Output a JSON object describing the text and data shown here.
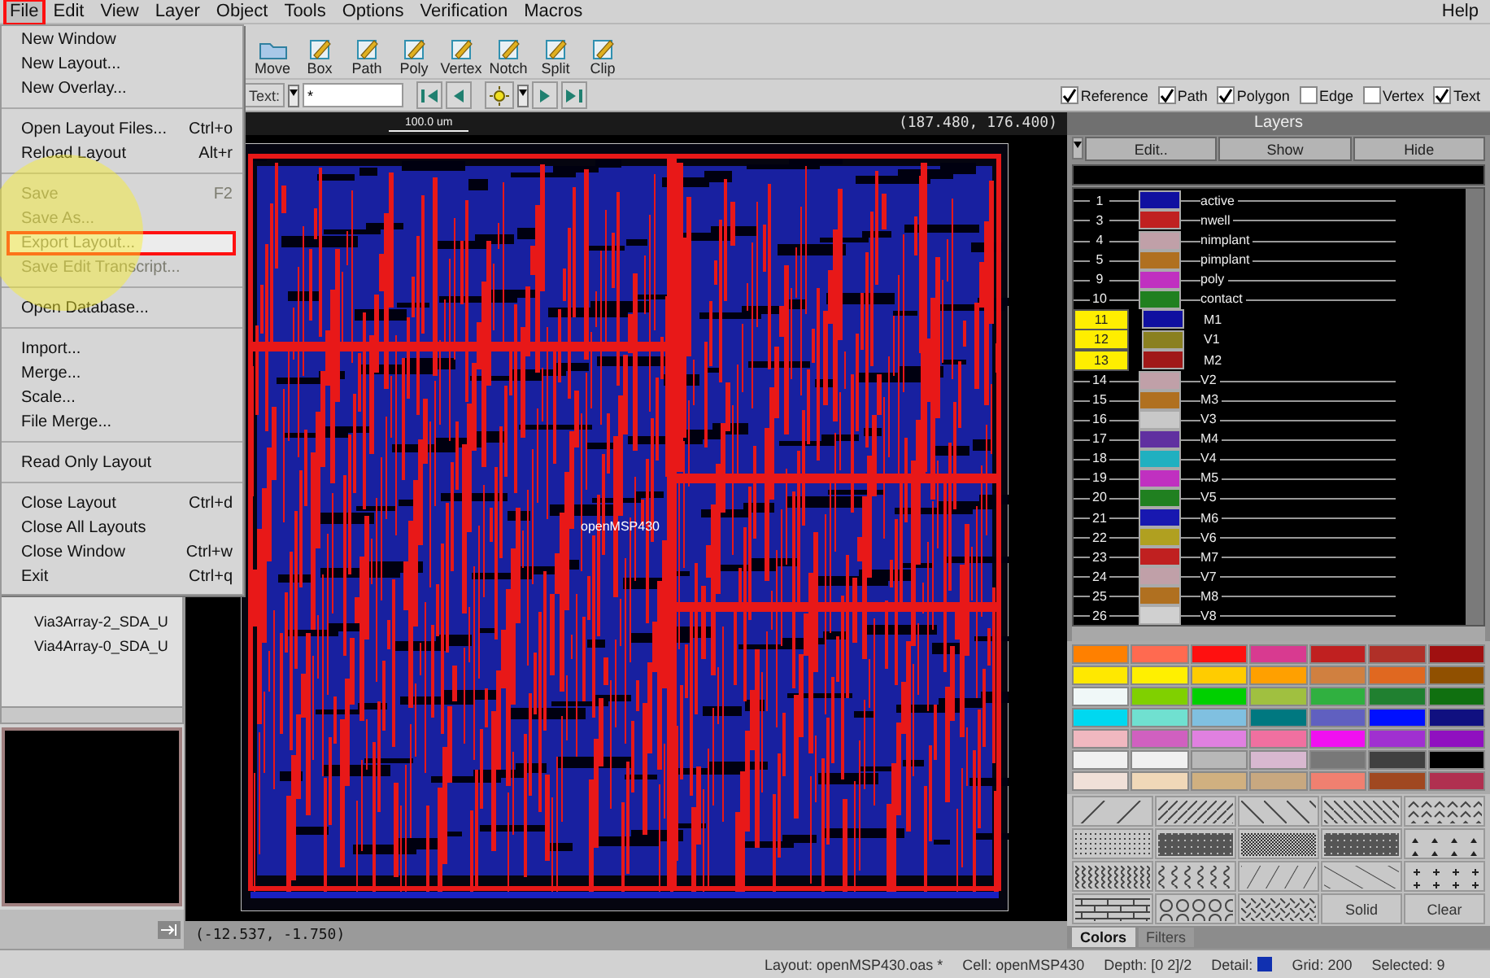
{
  "menubar": {
    "menus": [
      {
        "label": "File",
        "selected": true,
        "annotated": true
      },
      {
        "label": "Edit",
        "selected": false,
        "annotated": false
      },
      {
        "label": "View",
        "selected": false,
        "annotated": false
      },
      {
        "label": "Layer",
        "selected": false,
        "annotated": false
      },
      {
        "label": "Object",
        "selected": false,
        "annotated": false
      },
      {
        "label": "Tools",
        "selected": false,
        "annotated": false
      },
      {
        "label": "Options",
        "selected": false,
        "annotated": false
      },
      {
        "label": "Verification",
        "selected": false,
        "annotated": false
      },
      {
        "label": "Macros",
        "selected": false,
        "annotated": false
      }
    ],
    "help": "Help"
  },
  "file_menu": [
    {
      "kind": "item",
      "label": "New Window",
      "disabled": false,
      "annotated": false
    },
    {
      "kind": "item",
      "label": "New Layout...",
      "disabled": false,
      "annotated": false
    },
    {
      "kind": "item",
      "label": "New Overlay...",
      "disabled": false,
      "annotated": false
    },
    {
      "kind": "separator"
    },
    {
      "kind": "item",
      "label": "Open Layout Files...",
      "shortcut": "Ctrl+o",
      "disabled": false,
      "annotated": false
    },
    {
      "kind": "item",
      "label": "Reload Layout",
      "shortcut": "Alt+r",
      "disabled": false,
      "annotated": false
    },
    {
      "kind": "separator"
    },
    {
      "kind": "item",
      "label": "Save",
      "shortcut": "F2",
      "disabled": true,
      "annotated": false
    },
    {
      "kind": "item",
      "label": "Save As...",
      "disabled": true,
      "annotated": false
    },
    {
      "kind": "item",
      "label": "Export Layout...",
      "disabled": true,
      "annotated": true
    },
    {
      "kind": "item",
      "label": "Save Edit Transcript...",
      "disabled": true,
      "annotated": false
    },
    {
      "kind": "separator"
    },
    {
      "kind": "item",
      "label": "Open Database...",
      "disabled": false,
      "annotated": false
    },
    {
      "kind": "separator"
    },
    {
      "kind": "item",
      "label": "Import...",
      "disabled": false,
      "annotated": false
    },
    {
      "kind": "item",
      "label": "Merge...",
      "disabled": false,
      "annotated": false
    },
    {
      "kind": "item",
      "label": "Scale...",
      "disabled": false,
      "annotated": false
    },
    {
      "kind": "item",
      "label": "File Merge...",
      "disabled": false,
      "annotated": false
    },
    {
      "kind": "separator"
    },
    {
      "kind": "item",
      "label": "Read Only Layout",
      "disabled": false,
      "annotated": false
    },
    {
      "kind": "separator"
    },
    {
      "kind": "item",
      "label": "Close Layout",
      "shortcut": "Ctrl+d",
      "disabled": false,
      "annotated": false
    },
    {
      "kind": "item",
      "label": "Close All Layouts",
      "disabled": false,
      "annotated": false
    },
    {
      "kind": "item",
      "label": "Close Window",
      "shortcut": "Ctrl+w",
      "disabled": false,
      "annotated": false
    },
    {
      "kind": "item",
      "label": "Exit",
      "shortcut": "Ctrl+q",
      "disabled": false,
      "annotated": false
    }
  ],
  "tools": [
    "Move",
    "Box",
    "Path",
    "Poly",
    "Vertex",
    "Notch",
    "Split",
    "Clip"
  ],
  "filter_bar": {
    "text_mode": "Text:",
    "pattern": "*"
  },
  "show_filters": [
    {
      "label": "Reference",
      "checked": true
    },
    {
      "label": "Path",
      "checked": true
    },
    {
      "label": "Polygon",
      "checked": true
    },
    {
      "label": "Edge",
      "checked": false
    },
    {
      "label": "Vertex",
      "checked": false
    },
    {
      "label": "Text",
      "checked": true
    }
  ],
  "hierarchy": [
    "Via3Array-2_SDA_U",
    "Via4Array-0_SDA_U"
  ],
  "canvas": {
    "ruler": "100.0 um",
    "cursor_position": "(187.480, 176.400)",
    "cell_label": "openMSP430",
    "click_position": "(-12.537, -1.750)"
  },
  "layers_panel": {
    "title": "Layers",
    "buttons": [
      "Edit..",
      "Show",
      "Hide"
    ],
    "layers": [
      {
        "number": "1",
        "name": "active",
        "color": "#1010a0",
        "visible": false
      },
      {
        "number": "3",
        "name": "nwell",
        "color": "#c02020",
        "visible": false
      },
      {
        "number": "4",
        "name": "nimplant",
        "color": "#c0a0a8",
        "visible": false
      },
      {
        "number": "5",
        "name": "pimplant",
        "color": "#b07020",
        "visible": false
      },
      {
        "number": "9",
        "name": "poly",
        "color": "#c030c0",
        "visible": false
      },
      {
        "number": "10",
        "name": "contact",
        "color": "#208020",
        "visible": false
      },
      {
        "number": "11",
        "name": "M1",
        "color": "#1010a0",
        "visible": true
      },
      {
        "number": "12",
        "name": "V1",
        "color": "#8a8020",
        "visible": true
      },
      {
        "number": "13",
        "name": "M2",
        "color": "#a01818",
        "visible": true
      },
      {
        "number": "14",
        "name": "V2",
        "color": "#c0a0a8",
        "visible": false
      },
      {
        "number": "15",
        "name": "M3",
        "color": "#b07020",
        "visible": false
      },
      {
        "number": "16",
        "name": "V3",
        "color": "#c8c8c8",
        "visible": false
      },
      {
        "number": "17",
        "name": "M4",
        "color": "#6030a0",
        "visible": false
      },
      {
        "number": "18",
        "name": "V4",
        "color": "#20b0c0",
        "visible": false
      },
      {
        "number": "19",
        "name": "M5",
        "color": "#c030c0",
        "visible": false
      },
      {
        "number": "20",
        "name": "V5",
        "color": "#208020",
        "visible": false
      },
      {
        "number": "21",
        "name": "M6",
        "color": "#1818b0",
        "visible": false
      },
      {
        "number": "22",
        "name": "V6",
        "color": "#b0a020",
        "visible": false
      },
      {
        "number": "23",
        "name": "M7",
        "color": "#c02020",
        "visible": false
      },
      {
        "number": "24",
        "name": "V7",
        "color": "#c0a0a8",
        "visible": false
      },
      {
        "number": "25",
        "name": "M8",
        "color": "#b07020",
        "visible": false
      },
      {
        "number": "26",
        "name": "V8",
        "color": "#d0d0d0",
        "visible": false
      }
    ],
    "palette": [
      {
        "color": "#ff8000"
      },
      {
        "color": "#ff6a50"
      },
      {
        "color": "#ff1010"
      },
      {
        "color": "#d83a90"
      },
      {
        "color": "#c02020"
      },
      {
        "color": "#b03028"
      },
      {
        "color": "#a01010"
      },
      {
        "color": "#ffe800"
      },
      {
        "color": "#fff000"
      },
      {
        "color": "#ffcc00"
      },
      {
        "color": "#ffa000"
      },
      {
        "color": "#d08040"
      },
      {
        "color": "#e06820"
      },
      {
        "color": "#905000"
      },
      {
        "color": "#f0f8f8"
      },
      {
        "color": "#80d000"
      },
      {
        "color": "#00d000"
      },
      {
        "color": "#a0c040"
      },
      {
        "color": "#30b040"
      },
      {
        "color": "#208030"
      },
      {
        "color": "#107010"
      },
      {
        "color": "#00d8f0"
      },
      {
        "color": "#70e0d0"
      },
      {
        "color": "#80c0e0"
      },
      {
        "color": "#007880"
      },
      {
        "color": "#6060c0"
      },
      {
        "color": "#0010ff"
      },
      {
        "color": "#101080"
      },
      {
        "color": "#f0b8c0"
      },
      {
        "color": "#d060c0"
      },
      {
        "color": "#e080e0"
      },
      {
        "color": "#f070a0"
      },
      {
        "color": "#f010f0"
      },
      {
        "color": "#a030d0"
      },
      {
        "color": "#9010c0"
      },
      {
        "color": "#f0f0f0"
      },
      {
        "color": "#f0f0f0"
      },
      {
        "color": "#b8b8b8"
      },
      {
        "color": "#d8b8d0"
      },
      {
        "color": "#787878"
      },
      {
        "color": "#404040"
      },
      {
        "color": "#000000"
      },
      {
        "color": "#f0e0d8"
      },
      {
        "color": "#f0d8b8"
      },
      {
        "color": "#d0b080"
      },
      {
        "color": "#c8a880"
      },
      {
        "color": "#f08070"
      },
      {
        "color": "#a04820"
      },
      {
        "color": "#b03050"
      }
    ],
    "patterns": [
      {
        "kind": "slash"
      },
      {
        "kind": "slash-dense"
      },
      {
        "kind": "backslash"
      },
      {
        "kind": "backslash-dense"
      },
      {
        "kind": "chevrons"
      },
      {
        "kind": "dots"
      },
      {
        "kind": "grid"
      },
      {
        "kind": "checker"
      },
      {
        "kind": "grid"
      },
      {
        "kind": "triangles"
      },
      {
        "kind": "zigzag"
      },
      {
        "kind": "waves"
      },
      {
        "kind": "slash-wide"
      },
      {
        "kind": "backslash-wide"
      },
      {
        "kind": "plus"
      },
      {
        "kind": "bricks"
      },
      {
        "kind": "circles"
      },
      {
        "kind": "weave"
      },
      {
        "kind": "label",
        "label": "Solid"
      },
      {
        "kind": "label",
        "label": "Clear"
      }
    ],
    "tabs": [
      {
        "label": "Colors",
        "selected": true
      },
      {
        "label": "Filters",
        "selected": false
      }
    ]
  },
  "status_bar": {
    "layout": "Layout: openMSP430.oas *",
    "cell": "Cell: openMSP430",
    "depth": "Depth: [0 2]/2",
    "detail": "Detail:",
    "grid": "Grid: 200",
    "selected": "Selected: 9"
  }
}
